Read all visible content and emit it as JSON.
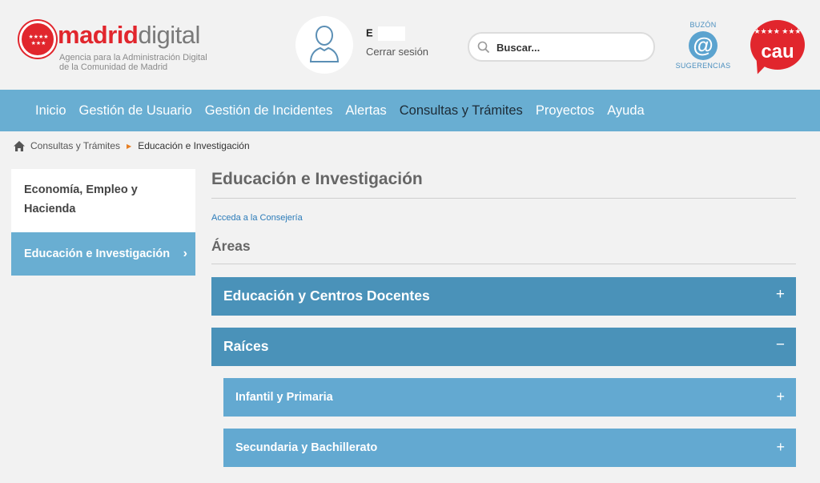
{
  "header": {
    "logo": {
      "name_part1": "madrid",
      "name_part2": "digital",
      "subtitle_line1": "Agencia para la Administración Digital",
      "subtitle_line2": "de la Comunidad de Madrid",
      "stars": "★★★★ ★★★"
    },
    "user": {
      "name": "E",
      "logout_label": "Cerrar sesión"
    },
    "search": {
      "placeholder": "Buscar..."
    },
    "buzon": {
      "top_label": "BUZÓN",
      "symbol": "@",
      "bottom_label": "SUGERENCIAS"
    },
    "cau": {
      "label": "cau",
      "stars": "★★★★ ★★★"
    }
  },
  "nav": {
    "items": [
      "Inicio",
      "Gestión de Usuario",
      "Gestión de Incidentes",
      "Alertas",
      "Consultas y Trámites",
      "Proyectos",
      "Ayuda"
    ],
    "active": "Consultas y Trámites"
  },
  "breadcrumb": {
    "items": [
      "Consultas y Trámites",
      "Educación e Investigación"
    ]
  },
  "sidebar": {
    "items": [
      {
        "label": "Economía, Empleo y Hacienda"
      },
      {
        "label": "Educación e Investigación",
        "active": true
      }
    ],
    "chevron": "›"
  },
  "main": {
    "title": "Educación e Investigación",
    "consejeria_link": "Acceda a la Consejería",
    "areas_heading": "Áreas",
    "accordion": [
      {
        "label": "Educación y Centros Docentes",
        "sign": "+"
      },
      {
        "label": "Raíces",
        "sign": "−"
      },
      {
        "label": "Infantil y Primaria",
        "sign": "+"
      },
      {
        "label": "Secundaria y Bachillerato",
        "sign": "+"
      }
    ]
  },
  "colors": {
    "brand_red": "#e1262d",
    "nav_blue": "#69aed2",
    "accordion_dark": "#4a92b9",
    "accordion_light": "#63a9d1",
    "link_blue": "#2b7bb9"
  }
}
